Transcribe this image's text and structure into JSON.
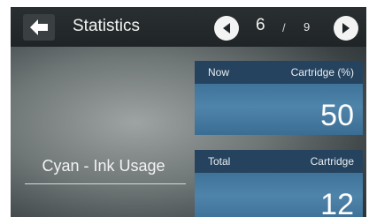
{
  "header": {
    "title": "Statistics",
    "page_current": "6",
    "page_separator": "/",
    "page_total": "9"
  },
  "icons": {
    "back": "arrow-left-icon",
    "prev": "triangle-left-icon",
    "next": "triangle-right-icon"
  },
  "main": {
    "label": "Cyan - Ink Usage",
    "cards": [
      {
        "left_label": "Now",
        "right_label": "Cartridge (%)",
        "value": "50"
      },
      {
        "left_label": "Total",
        "right_label": "Cartridge",
        "value": "12"
      }
    ]
  },
  "colors": {
    "card_header": "#25435e",
    "card_body": "#4a7fa6",
    "topbar": "#23282a"
  }
}
